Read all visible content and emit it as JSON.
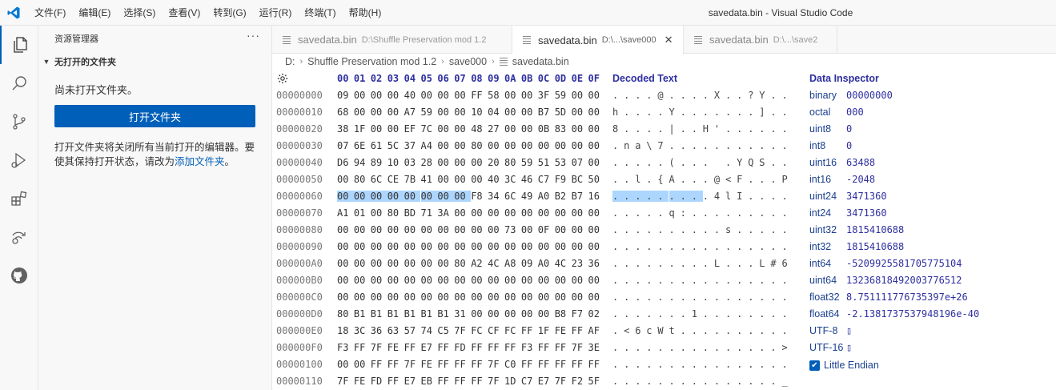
{
  "app": {
    "title": "savedata.bin - Visual Studio Code"
  },
  "menu": [
    "文件(F)",
    "编辑(E)",
    "选择(S)",
    "查看(V)",
    "转到(G)",
    "运行(R)",
    "终端(T)",
    "帮助(H)"
  ],
  "sidebar": {
    "title": "资源管理器",
    "section": "无打开的文件夹",
    "no_folder": "尚未打开文件夹。",
    "open_button": "打开文件夹",
    "note": "打开文件夹将关闭所有当前打开的编辑器。要使其保持打开状态，请改为",
    "add_link": "添加文件夹",
    "note_end": "。"
  },
  "tabs": [
    {
      "name": "savedata.bin",
      "desc": "D:\\Shuffle Preservation mod 1.2",
      "active": false
    },
    {
      "name": "savedata.bin",
      "desc": "D:\\...\\save000",
      "active": true
    },
    {
      "name": "savedata.bin",
      "desc": "D:\\...\\save2",
      "active": false
    }
  ],
  "breadcrumb": [
    "D:",
    "Shuffle Preservation mod 1.2",
    "save000",
    "savedata.bin"
  ],
  "hex": {
    "columns": [
      "00",
      "01",
      "02",
      "03",
      "04",
      "05",
      "06",
      "07",
      "08",
      "09",
      "0A",
      "0B",
      "0C",
      "0D",
      "0E",
      "0F"
    ],
    "decoded_header": "Decoded Text",
    "rows": [
      {
        "addr": "00000000",
        "bytes": [
          "09",
          "00",
          "00",
          "00",
          "40",
          "00",
          "00",
          "00",
          "FF",
          "58",
          "00",
          "00",
          "3F",
          "59",
          "00",
          "00"
        ],
        "text": [
          ".",
          ".",
          ".",
          ".",
          "@",
          ".",
          ".",
          ".",
          ".",
          "X",
          ".",
          ".",
          "?",
          "Y",
          ".",
          "."
        ]
      },
      {
        "addr": "00000010",
        "bytes": [
          "68",
          "00",
          "00",
          "00",
          "A7",
          "59",
          "00",
          "00",
          "10",
          "04",
          "00",
          "00",
          "B7",
          "5D",
          "00",
          "00"
        ],
        "text": [
          "h",
          ".",
          ".",
          ".",
          ".",
          "Y",
          ".",
          ".",
          ".",
          ".",
          ".",
          ".",
          ".",
          "]",
          ".",
          "."
        ]
      },
      {
        "addr": "00000020",
        "bytes": [
          "38",
          "1F",
          "00",
          "00",
          "EF",
          "7C",
          "00",
          "00",
          "48",
          "27",
          "00",
          "00",
          "0B",
          "83",
          "00",
          "00"
        ],
        "text": [
          "8",
          ".",
          ".",
          ".",
          ".",
          "|",
          ".",
          ".",
          "H",
          "'",
          ".",
          ".",
          ".",
          ".",
          ".",
          "."
        ]
      },
      {
        "addr": "00000030",
        "bytes": [
          "07",
          "6E",
          "61",
          "5C",
          "37",
          "A4",
          "00",
          "00",
          "80",
          "00",
          "00",
          "00",
          "00",
          "00",
          "00",
          "00"
        ],
        "text": [
          ".",
          "n",
          "a",
          "\\",
          "7",
          ".",
          ".",
          ".",
          ".",
          ".",
          ".",
          ".",
          ".",
          ".",
          ".",
          "."
        ]
      },
      {
        "addr": "00000040",
        "bytes": [
          "D6",
          "94",
          "89",
          "10",
          "03",
          "28",
          "00",
          "00",
          "00",
          "20",
          "80",
          "59",
          "51",
          "53",
          "07",
          "00"
        ],
        "text": [
          ".",
          ".",
          ".",
          ".",
          ".",
          "(",
          ".",
          ".",
          ".",
          " ",
          ".",
          "Y",
          "Q",
          "S",
          ".",
          "."
        ]
      },
      {
        "addr": "00000050",
        "bytes": [
          "00",
          "80",
          "6C",
          "CE",
          "7B",
          "41",
          "00",
          "00",
          "00",
          "40",
          "3C",
          "46",
          "C7",
          "F9",
          "BC",
          "50"
        ],
        "text": [
          ".",
          ".",
          "l",
          ".",
          "{",
          "A",
          ".",
          ".",
          ".",
          "@",
          "<",
          "F",
          ".",
          ".",
          ".",
          "P"
        ]
      },
      {
        "addr": "00000060",
        "bytes": [
          "00",
          "00",
          "00",
          "00",
          "00",
          "00",
          "00",
          "00",
          "F8",
          "34",
          "6C",
          "49",
          "A0",
          "B2",
          "B7",
          "16"
        ],
        "text": [
          ".",
          ".",
          ".",
          ".",
          ".",
          ".",
          ".",
          ".",
          ".",
          "4",
          "l",
          "I",
          ".",
          ".",
          ".",
          "."
        ],
        "sel": 8
      },
      {
        "addr": "00000070",
        "bytes": [
          "A1",
          "01",
          "00",
          "80",
          "BD",
          "71",
          "3A",
          "00",
          "00",
          "00",
          "00",
          "00",
          "00",
          "00",
          "00",
          "00"
        ],
        "text": [
          ".",
          ".",
          ".",
          ".",
          ".",
          "q",
          ":",
          ".",
          ".",
          ".",
          ".",
          ".",
          ".",
          ".",
          ".",
          "."
        ]
      },
      {
        "addr": "00000080",
        "bytes": [
          "00",
          "00",
          "00",
          "00",
          "00",
          "00",
          "00",
          "00",
          "00",
          "00",
          "73",
          "00",
          "0F",
          "00",
          "00",
          "00"
        ],
        "text": [
          ".",
          ".",
          ".",
          ".",
          ".",
          ".",
          ".",
          ".",
          ".",
          ".",
          "s",
          ".",
          ".",
          ".",
          ".",
          "."
        ]
      },
      {
        "addr": "00000090",
        "bytes": [
          "00",
          "00",
          "00",
          "00",
          "00",
          "00",
          "00",
          "00",
          "00",
          "00",
          "00",
          "00",
          "00",
          "00",
          "00",
          "00"
        ],
        "text": [
          ".",
          ".",
          ".",
          ".",
          ".",
          ".",
          ".",
          ".",
          ".",
          ".",
          ".",
          ".",
          ".",
          ".",
          ".",
          "."
        ]
      },
      {
        "addr": "000000A0",
        "bytes": [
          "00",
          "00",
          "00",
          "00",
          "00",
          "00",
          "00",
          "80",
          "A2",
          "4C",
          "A8",
          "09",
          "A0",
          "4C",
          "23",
          "36"
        ],
        "text": [
          ".",
          ".",
          ".",
          ".",
          ".",
          ".",
          ".",
          ".",
          ".",
          "L",
          ".",
          ".",
          ".",
          "L",
          "#",
          "6"
        ]
      },
      {
        "addr": "000000B0",
        "bytes": [
          "00",
          "00",
          "00",
          "00",
          "00",
          "00",
          "00",
          "00",
          "00",
          "00",
          "00",
          "00",
          "00",
          "00",
          "00",
          "00"
        ],
        "text": [
          ".",
          ".",
          ".",
          ".",
          ".",
          ".",
          ".",
          ".",
          ".",
          ".",
          ".",
          ".",
          ".",
          ".",
          ".",
          "."
        ]
      },
      {
        "addr": "000000C0",
        "bytes": [
          "00",
          "00",
          "00",
          "00",
          "00",
          "00",
          "00",
          "00",
          "00",
          "00",
          "00",
          "00",
          "00",
          "00",
          "00",
          "00"
        ],
        "text": [
          ".",
          ".",
          ".",
          ".",
          ".",
          ".",
          ".",
          ".",
          ".",
          ".",
          ".",
          ".",
          ".",
          ".",
          ".",
          "."
        ]
      },
      {
        "addr": "000000D0",
        "bytes": [
          "80",
          "B1",
          "B1",
          "B1",
          "B1",
          "B1",
          "B1",
          "31",
          "00",
          "00",
          "00",
          "00",
          "00",
          "B8",
          "F7",
          "02"
        ],
        "text": [
          ".",
          ".",
          ".",
          ".",
          ".",
          ".",
          ".",
          "1",
          ".",
          ".",
          ".",
          ".",
          ".",
          ".",
          ".",
          "."
        ]
      },
      {
        "addr": "000000E0",
        "bytes": [
          "18",
          "3C",
          "36",
          "63",
          "57",
          "74",
          "C5",
          "7F",
          "FC",
          "CF",
          "FC",
          "FF",
          "1F",
          "FE",
          "FF",
          "AF"
        ],
        "text": [
          ".",
          "<",
          "6",
          "c",
          "W",
          "t",
          ".",
          ".",
          ".",
          ".",
          ".",
          ".",
          ".",
          ".",
          ".",
          "."
        ]
      },
      {
        "addr": "000000F0",
        "bytes": [
          "F3",
          "FF",
          "7F",
          "FE",
          "FF",
          "E7",
          "FF",
          "FD",
          "FF",
          "FF",
          "FF",
          "F3",
          "FF",
          "FF",
          "7F",
          "3E"
        ],
        "text": [
          ".",
          ".",
          ".",
          ".",
          ".",
          ".",
          ".",
          ".",
          ".",
          ".",
          ".",
          ".",
          ".",
          ".",
          ".",
          ">"
        ]
      },
      {
        "addr": "00000100",
        "bytes": [
          "00",
          "00",
          "FF",
          "FF",
          "7F",
          "FE",
          "FF",
          "FF",
          "FF",
          "7F",
          "C0",
          "FF",
          "FF",
          "FF",
          "FF",
          "FF"
        ],
        "text": [
          ".",
          ".",
          ".",
          ".",
          ".",
          ".",
          ".",
          ".",
          ".",
          ".",
          ".",
          ".",
          ".",
          ".",
          ".",
          "."
        ]
      },
      {
        "addr": "00000110",
        "bytes": [
          "7F",
          "FE",
          "FD",
          "FF",
          "E7",
          "EB",
          "FF",
          "FF",
          "FF",
          "7F",
          "1D",
          "C7",
          "E7",
          "7F",
          "F2",
          "5F"
        ],
        "text": [
          ".",
          ".",
          ".",
          ".",
          ".",
          ".",
          ".",
          ".",
          ".",
          ".",
          ".",
          ".",
          ".",
          ".",
          ".",
          "_"
        ]
      }
    ]
  },
  "inspector": {
    "title": "Data Inspector",
    "fields": [
      {
        "name": "binary",
        "value": "00000000"
      },
      {
        "name": "octal",
        "value": "000"
      },
      {
        "name": "uint8",
        "value": "0"
      },
      {
        "name": "int8",
        "value": "0"
      },
      {
        "name": "uint16",
        "value": "63488"
      },
      {
        "name": "int16",
        "value": "-2048"
      },
      {
        "name": "uint24",
        "value": "3471360"
      },
      {
        "name": "int24",
        "value": "3471360"
      },
      {
        "name": "uint32",
        "value": "1815410688"
      },
      {
        "name": "int32",
        "value": "1815410688"
      },
      {
        "name": "int64",
        "value": "-5209925581705775104"
      },
      {
        "name": "uint64",
        "value": "13236818492003776512"
      },
      {
        "name": "float32",
        "value": "8.751111776735397e+26"
      },
      {
        "name": "float64",
        "value": "-2.1381737537948196e-40"
      },
      {
        "name": "UTF-8",
        "value": "▯"
      },
      {
        "name": "UTF-16",
        "value": "▯"
      }
    ],
    "little_endian": "Little Endian"
  },
  "colors": {
    "accent": "#005fb8",
    "selection": "#add6ff",
    "header": "#2e2fa0"
  }
}
